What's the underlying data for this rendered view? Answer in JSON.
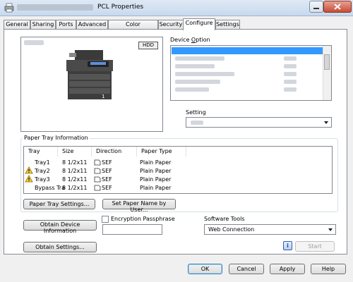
{
  "window": {
    "title": "PCL Properties"
  },
  "tabs": [
    {
      "label": "General"
    },
    {
      "label": "Sharing"
    },
    {
      "label": "Ports"
    },
    {
      "label": "Advanced"
    },
    {
      "label": "Color Management"
    },
    {
      "label": "Security"
    },
    {
      "label": "Configure"
    },
    {
      "label": "Settings"
    }
  ],
  "preview": {
    "hdd_badge": "HDD"
  },
  "device_option": {
    "label_pre": "Device ",
    "label_u": "O",
    "label_post": "ption"
  },
  "setting": {
    "label": "Setting"
  },
  "paper_tray": {
    "label": "Paper Tray Information",
    "columns": [
      "Tray",
      "Size",
      "Direction",
      "Paper Type"
    ],
    "rows": [
      {
        "tray": "Tray1",
        "size": "8 1/2x11",
        "direction": "SEF",
        "type": "Plain Paper",
        "warning": false
      },
      {
        "tray": "Tray2",
        "size": "8 1/2x11",
        "direction": "SEF",
        "type": "Plain Paper",
        "warning": true
      },
      {
        "tray": "Tray3",
        "size": "8 1/2x11",
        "direction": "SEF",
        "type": "Plain Paper",
        "warning": true
      },
      {
        "tray": "Bypass Tra",
        "size": "8 1/2x11",
        "direction": "SEF",
        "type": "Plain Paper",
        "warning": false
      }
    ],
    "settings_btn": "Paper Tray Settings...",
    "set_name_btn": "Set Paper Name by User..."
  },
  "obtain_device_btn": "Obtain Device Information",
  "obtain_settings_btn": "Obtain Settings...",
  "encryption": {
    "label": "Encryption Passphrase",
    "checked": false,
    "value": ""
  },
  "software_tools": {
    "label": "Software Tools",
    "selected": "Web Connection",
    "info_icon": "i",
    "start_btn": "Start"
  },
  "footer": {
    "ok": "OK",
    "cancel": "Cancel",
    "apply": "Apply",
    "help": "Help"
  }
}
